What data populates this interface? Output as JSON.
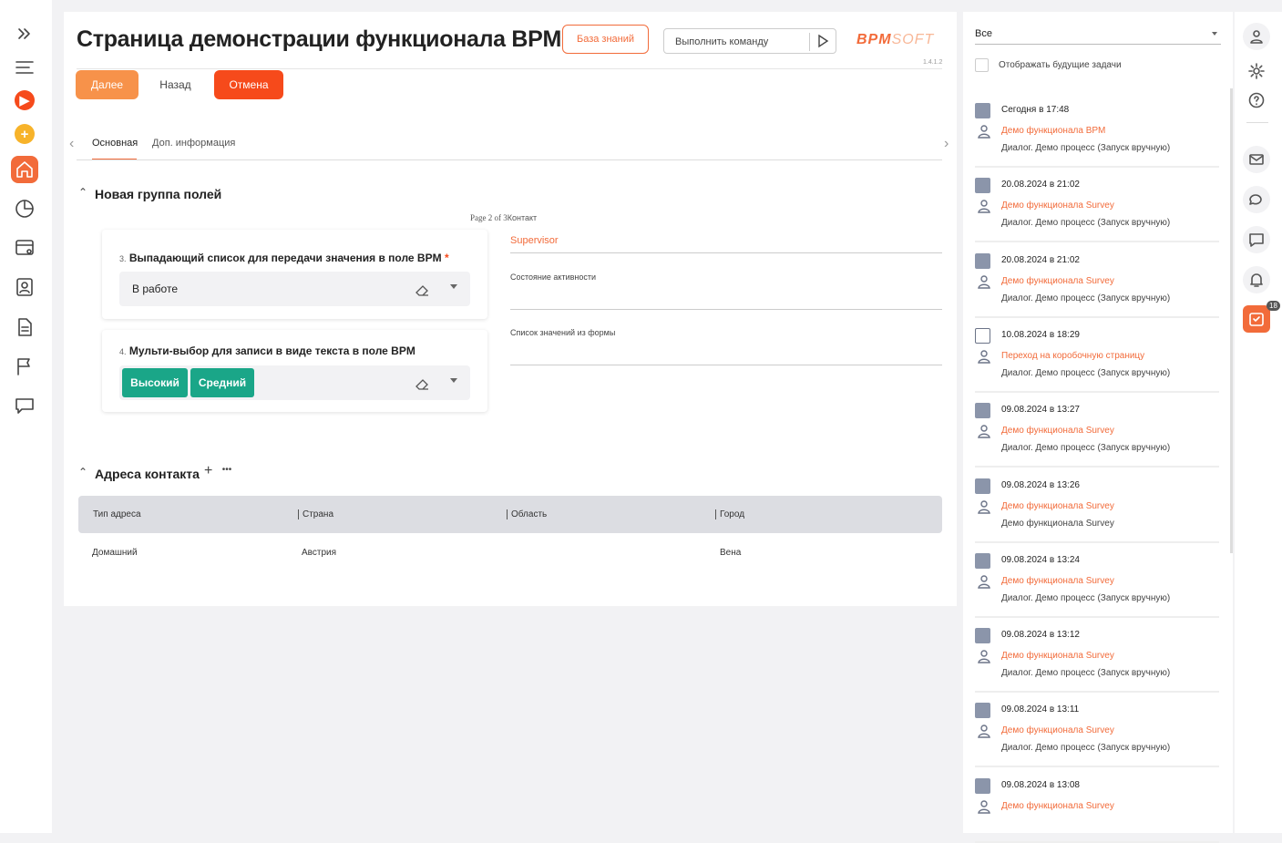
{
  "page": {
    "title": "Страница демонстрации функционала BPM",
    "knowledge_base": "База знаний",
    "command_placeholder": "Выполнить команду",
    "logo_main": "BPM",
    "logo_sub": "SOFT",
    "version": "1.4.1.2"
  },
  "actions": {
    "next": "Далее",
    "back": "Назад",
    "cancel": "Отмена"
  },
  "tabs": [
    {
      "label": "Основная",
      "active": true
    },
    {
      "label": "Доп. информация",
      "active": false
    }
  ],
  "fields_group": {
    "title": "Новая группа полей",
    "page_label_prefix": "Page 2 of 3",
    "page_label_suffix": "Контакт",
    "field3": {
      "num": "3.",
      "label": "Выпадающий список для передачи значения в поле BPM",
      "required": "*",
      "value": "В работе"
    },
    "field4": {
      "num": "4.",
      "label": "Мульти-выбор для записи в виде текста в поле BPM",
      "tags": [
        "Высокий",
        "Средний"
      ]
    },
    "supervisor": "Supervisor",
    "activity_state": "Состояние активности",
    "values_list": "Список значений из формы"
  },
  "addresses": {
    "title": "Адреса контакта",
    "add": "+",
    "more": "•••",
    "columns": [
      "Тип адреса",
      "Страна",
      "Область",
      "Город"
    ],
    "rows": [
      [
        "Домашний",
        "Австрия",
        "",
        "Вена"
      ]
    ]
  },
  "tasks_panel": {
    "filter": "Все",
    "future_label": "Отображать будущие задачи",
    "items": [
      {
        "time": "Сегодня в 17:48",
        "link": "Демо функционала BPM",
        "desc": "Диалог. Демо процесс (Запуск вручную)",
        "icon": "user-task-icon"
      },
      {
        "time": "20.08.2024 в 21:02",
        "link": "Демо функционала Survey",
        "desc": "Диалог. Демо процесс (Запуск вручную)",
        "icon": "user-task-icon"
      },
      {
        "time": "20.08.2024 в 21:02",
        "link": "Демо функционала Survey",
        "desc": "Диалог. Демо процесс (Запуск вручную)",
        "icon": "user-task-icon"
      },
      {
        "time": "10.08.2024 в 18:29",
        "link": "Переход на коробочную страницу",
        "desc": "Диалог. Демо процесс (Запуск вручную)",
        "icon": "calendar-task-icon"
      },
      {
        "time": "09.08.2024 в 13:27",
        "link": "Демо функционала Survey",
        "desc": "Диалог. Демо процесс (Запуск вручную)",
        "icon": "user-task-icon"
      },
      {
        "time": "09.08.2024 в 13:26",
        "link": "Демо функционала Survey",
        "desc": "Демо функционала Survey",
        "icon": "user-task-icon"
      },
      {
        "time": "09.08.2024 в 13:24",
        "link": "Демо функционала Survey",
        "desc": "Диалог. Демо процесс (Запуск вручную)",
        "icon": "user-task-icon"
      },
      {
        "time": "09.08.2024 в 13:12",
        "link": "Демо функционала Survey",
        "desc": "Диалог. Демо процесс (Запуск вручную)",
        "icon": "user-task-icon"
      },
      {
        "time": "09.08.2024 в 13:11",
        "link": "Демо функционала Survey",
        "desc": "Диалог. Демо процесс (Запуск вручную)",
        "icon": "user-task-icon"
      },
      {
        "time": "09.08.2024 в 13:08",
        "link": "Демо функционала Survey",
        "desc": "",
        "icon": "user-task-icon"
      }
    ]
  },
  "rightbar": {
    "badge": "18"
  },
  "colors": {
    "accent": "#f26b3a",
    "cancel": "#f64a1b",
    "next": "#f7924a",
    "tag": "#1aa688"
  }
}
